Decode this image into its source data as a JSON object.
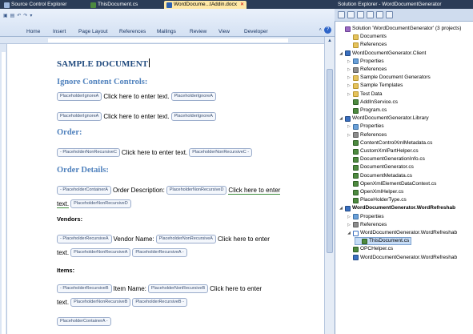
{
  "tabs": [
    {
      "label": "Source Control Explorer",
      "active": false
    },
    {
      "label": "ThisDocument.cs",
      "active": false
    },
    {
      "label": "WordDocume...tAddin.docx",
      "active": true
    }
  ],
  "ribbon": {
    "tabs": [
      "Home",
      "Insert",
      "Page Layout",
      "References",
      "Mailings",
      "Review",
      "View",
      "Developer"
    ]
  },
  "document": {
    "title": "SAMPLE DOCUMENT",
    "sections": {
      "ignore": {
        "heading": "Ignore Content Controls:",
        "line1": {
          "cc1": "PlaceholderIgnoreA",
          "text": "Click here to enter text.",
          "cc2": "PlaceholderIgnoreA"
        },
        "line2": {
          "cc1": "PlaceholderIgnoreA",
          "text": "Click here to enter text.",
          "cc2": "PlaceholderIgnoreA"
        }
      },
      "order": {
        "heading": "Order:",
        "line1": {
          "cc1": "- PlaceholderNonRecursiveC",
          "text": "Click here to enter text.",
          "cc2": "PlaceholderNonRecursiveC -"
        }
      },
      "order_details": {
        "heading": "Order Details:",
        "line1": {
          "cc1": "- PlaceholderContainerA",
          "text1": "Order Description:",
          "cc2": "PlaceholderNonRecursiveD",
          "text2": "Click here to enter"
        },
        "line2": {
          "text": "text.",
          "cc": "PlaceholderNonRecursiveD"
        }
      },
      "vendors": {
        "heading": "Vendors:",
        "line1": {
          "cc1": "- PlaceholderRecursiveA",
          "text1": "Vendor Name:",
          "cc2": "PlaceholderNonRecursiveA",
          "text2": "Click here to enter"
        },
        "line2": {
          "text": "text.",
          "cc1": "PlaceholderNonRecursiveA",
          "cc2": "PlaceholderRecursiveA -"
        }
      },
      "items": {
        "heading": "Items:",
        "line1": {
          "cc1": "- PlaceholderRecursiveB",
          "text1": "Item Name:",
          "cc2": "PlaceholderNonRecursiveB",
          "text2": "Click here to enter"
        },
        "line2": {
          "text": "text.",
          "cc1": "PlaceholderNonRecursiveB",
          "cc2": "PlaceholderRecursiveB -"
        }
      },
      "container_end": "PlaceholderContainerA -"
    }
  },
  "solution_explorer": {
    "title": "Solution Explorer - WordDocumentGenerator",
    "nodes": [
      {
        "label": "Solution 'WordDocumentGenerator' (3 projects)",
        "icon": "solution-icon",
        "level": 0,
        "exp": ""
      },
      {
        "label": "Documents",
        "icon": "folder-icon",
        "level": 1,
        "exp": ""
      },
      {
        "label": "References",
        "icon": "folder-icon",
        "level": 1,
        "exp": ""
      },
      {
        "label": "WordDocumentGenerator.Client",
        "icon": "project-icon",
        "level": 0,
        "exp": "◢"
      },
      {
        "label": "Properties",
        "icon": "properties-icon",
        "level": 1,
        "exp": "▷"
      },
      {
        "label": "References",
        "icon": "references-icon",
        "level": 1,
        "exp": "▷"
      },
      {
        "label": "Sample Document Generators",
        "icon": "folder-icon",
        "level": 1,
        "exp": "▷"
      },
      {
        "label": "Sample Templates",
        "icon": "folder-icon",
        "level": 1,
        "exp": "▷"
      },
      {
        "label": "Test Data",
        "icon": "folder-icon",
        "level": 1,
        "exp": "▷"
      },
      {
        "label": "AddInService.cs",
        "icon": "cs-file-icon",
        "level": 1,
        "exp": ""
      },
      {
        "label": "Program.cs",
        "icon": "cs-file-icon",
        "level": 1,
        "exp": ""
      },
      {
        "label": "WordDocumentGenerator.Library",
        "icon": "project-icon",
        "level": 0,
        "exp": "◢"
      },
      {
        "label": "Properties",
        "icon": "properties-icon",
        "level": 1,
        "exp": "▷"
      },
      {
        "label": "References",
        "icon": "references-icon",
        "level": 1,
        "exp": "▷"
      },
      {
        "label": "ContentControlXmlMetadata.cs",
        "icon": "cs-file-icon",
        "level": 1,
        "exp": ""
      },
      {
        "label": "CustomXmlPartHelper.cs",
        "icon": "cs-file-icon",
        "level": 1,
        "exp": ""
      },
      {
        "label": "DocumentGenerationInfo.cs",
        "icon": "cs-file-icon",
        "level": 1,
        "exp": ""
      },
      {
        "label": "DocumentGenerator.cs",
        "icon": "cs-file-icon",
        "level": 1,
        "exp": ""
      },
      {
        "label": "DocumentMetadata.cs",
        "icon": "cs-file-icon",
        "level": 1,
        "exp": ""
      },
      {
        "label": "OpenXmlElementDataContext.cs",
        "icon": "cs-file-icon",
        "level": 1,
        "exp": ""
      },
      {
        "label": "OpenXmlHelper.cs",
        "icon": "cs-file-icon",
        "level": 1,
        "exp": ""
      },
      {
        "label": "PlaceHolderType.cs",
        "icon": "cs-file-icon",
        "level": 1,
        "exp": ""
      },
      {
        "label": "WordDocumentGenerator.WordRefreshab",
        "icon": "project-icon",
        "level": 0,
        "exp": "◢",
        "bold": true
      },
      {
        "label": "Properties",
        "icon": "properties-icon",
        "level": 1,
        "exp": "▷"
      },
      {
        "label": "References",
        "icon": "references-icon",
        "level": 1,
        "exp": "▷"
      },
      {
        "label": "WordDocumentGenerator.WordRefreshab",
        "icon": "word-doc-icon",
        "level": 1,
        "exp": "◢"
      },
      {
        "label": "ThisDocument.cs",
        "icon": "cs-file-icon",
        "level": 2,
        "exp": "",
        "selected": true
      },
      {
        "label": "OPCHelper.cs",
        "icon": "cs-file-icon",
        "level": 1,
        "exp": ""
      },
      {
        "label": "WordDocumentGenerator.WordRefreshab",
        "icon": "project-file-icon",
        "level": 1,
        "exp": ""
      }
    ]
  }
}
